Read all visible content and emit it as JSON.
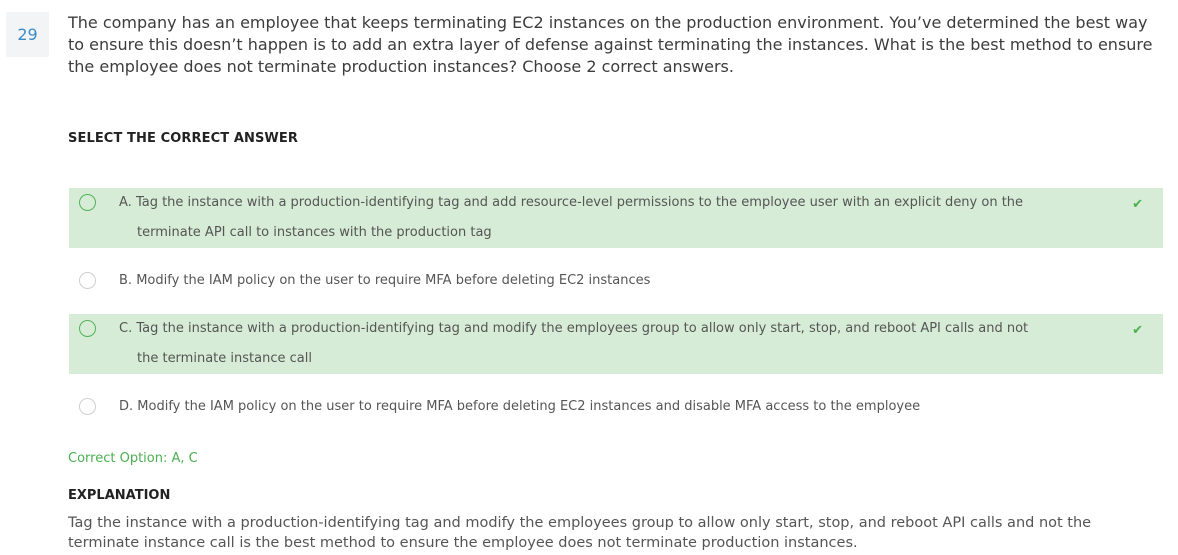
{
  "question": {
    "number": "29",
    "text": "The company has an employee that keeps terminating EC2 instances on the production environment. You’ve determined the best way to ensure this doesn’t happen is to add an extra layer of defense against terminating the instances. What is the best method to ensure the employee does not terminate production instances? Choose 2 correct answers."
  },
  "select_title": "SELECT THE CORRECT ANSWER",
  "options": [
    {
      "letter": "A.",
      "text": "Tag the instance with a production-identifying tag and add resource-level permissions to the employee user with an explicit deny on the",
      "text2": "terminate API call to instances with the production tag",
      "correct": true,
      "check": "✔"
    },
    {
      "letter": "B.",
      "text": "Modify the IAM policy on the user to require MFA before deleting EC2 instances",
      "correct": false
    },
    {
      "letter": "C.",
      "text": "Tag the instance with a production-identifying tag and modify the employees group to allow only start, stop, and reboot API calls and not",
      "text2": "the terminate instance call",
      "correct": true,
      "check": "✔"
    },
    {
      "letter": "D.",
      "text": "Modify the IAM policy on the user to require MFA before deleting EC2 instances and disable MFA access to the employee",
      "correct": false
    }
  ],
  "correct_option": "Correct Option: A, C",
  "explanation": {
    "title": "EXPLANATION",
    "text": "Tag the instance with a production-identifying tag and modify the employees group to allow only start, stop, and reboot API calls and not the terminate instance call is the best method to ensure the employee does not terminate production instances."
  },
  "colors": {
    "correct_bg": "#d6ecd6",
    "correct_green": "#4caf50",
    "number_blue": "#3a8bc9"
  }
}
